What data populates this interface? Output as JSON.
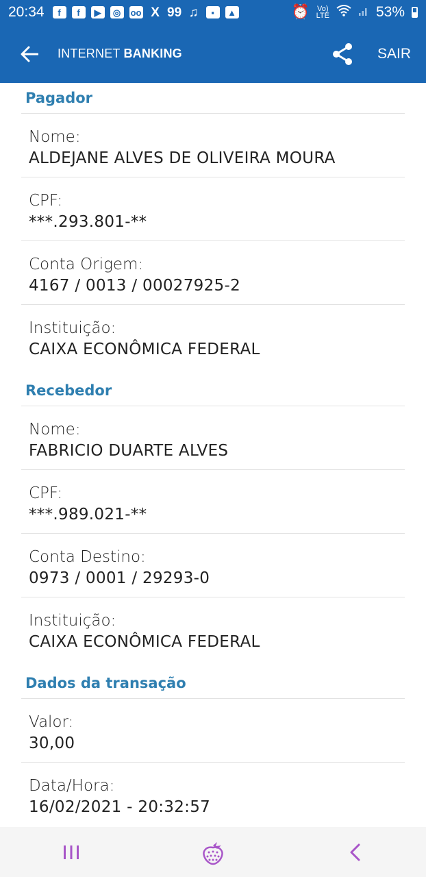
{
  "status_bar": {
    "time": "20:34",
    "icons": [
      "facebook-icon",
      "facebook-icon",
      "youtube-icon",
      "instagram-icon",
      "voicemail-icon",
      "x-icon",
      "99-icon",
      "music-icon",
      "dropbox-icon",
      "gallery-icon"
    ],
    "icon_x_text": "X",
    "icon_99_text": "99",
    "volte_top": "Vo)",
    "volte_bottom": "LTE",
    "battery": "53%"
  },
  "app_bar": {
    "title_regular": "INTERNET ",
    "title_bold": "BANKING",
    "sair_label": "SAIR"
  },
  "pagador": {
    "title": "Pagador",
    "rows": [
      {
        "label": "Nome:",
        "value": "ALDEJANE ALVES DE OLIVEIRA MOURA"
      },
      {
        "label": "CPF:",
        "value": "***.293.801-**"
      },
      {
        "label": "Conta Origem:",
        "value": "4167 / 0013 / 00027925-2"
      },
      {
        "label": "Instituição:",
        "value": "CAIXA ECONÔMICA FEDERAL"
      }
    ]
  },
  "recebedor": {
    "title": "Recebedor",
    "rows": [
      {
        "label": "Nome:",
        "value": "FABRICIO DUARTE ALVES"
      },
      {
        "label": "CPF:",
        "value": "***.989.021-**"
      },
      {
        "label": "Conta Destino:",
        "value": "0973 / 0001 / 29293-0"
      },
      {
        "label": "Instituição:",
        "value": "CAIXA ECONÔMICA FEDERAL"
      }
    ]
  },
  "transacao": {
    "title": "Dados da transação",
    "rows": [
      {
        "label": "Valor:",
        "value": "30,00"
      },
      {
        "label": "Data/Hora:",
        "value": "16/02/2021 - 20:32:57"
      }
    ]
  },
  "colors": {
    "primary": "#1a67b4",
    "section_title": "#2f7fb0",
    "nav_accent": "#a855c8"
  }
}
